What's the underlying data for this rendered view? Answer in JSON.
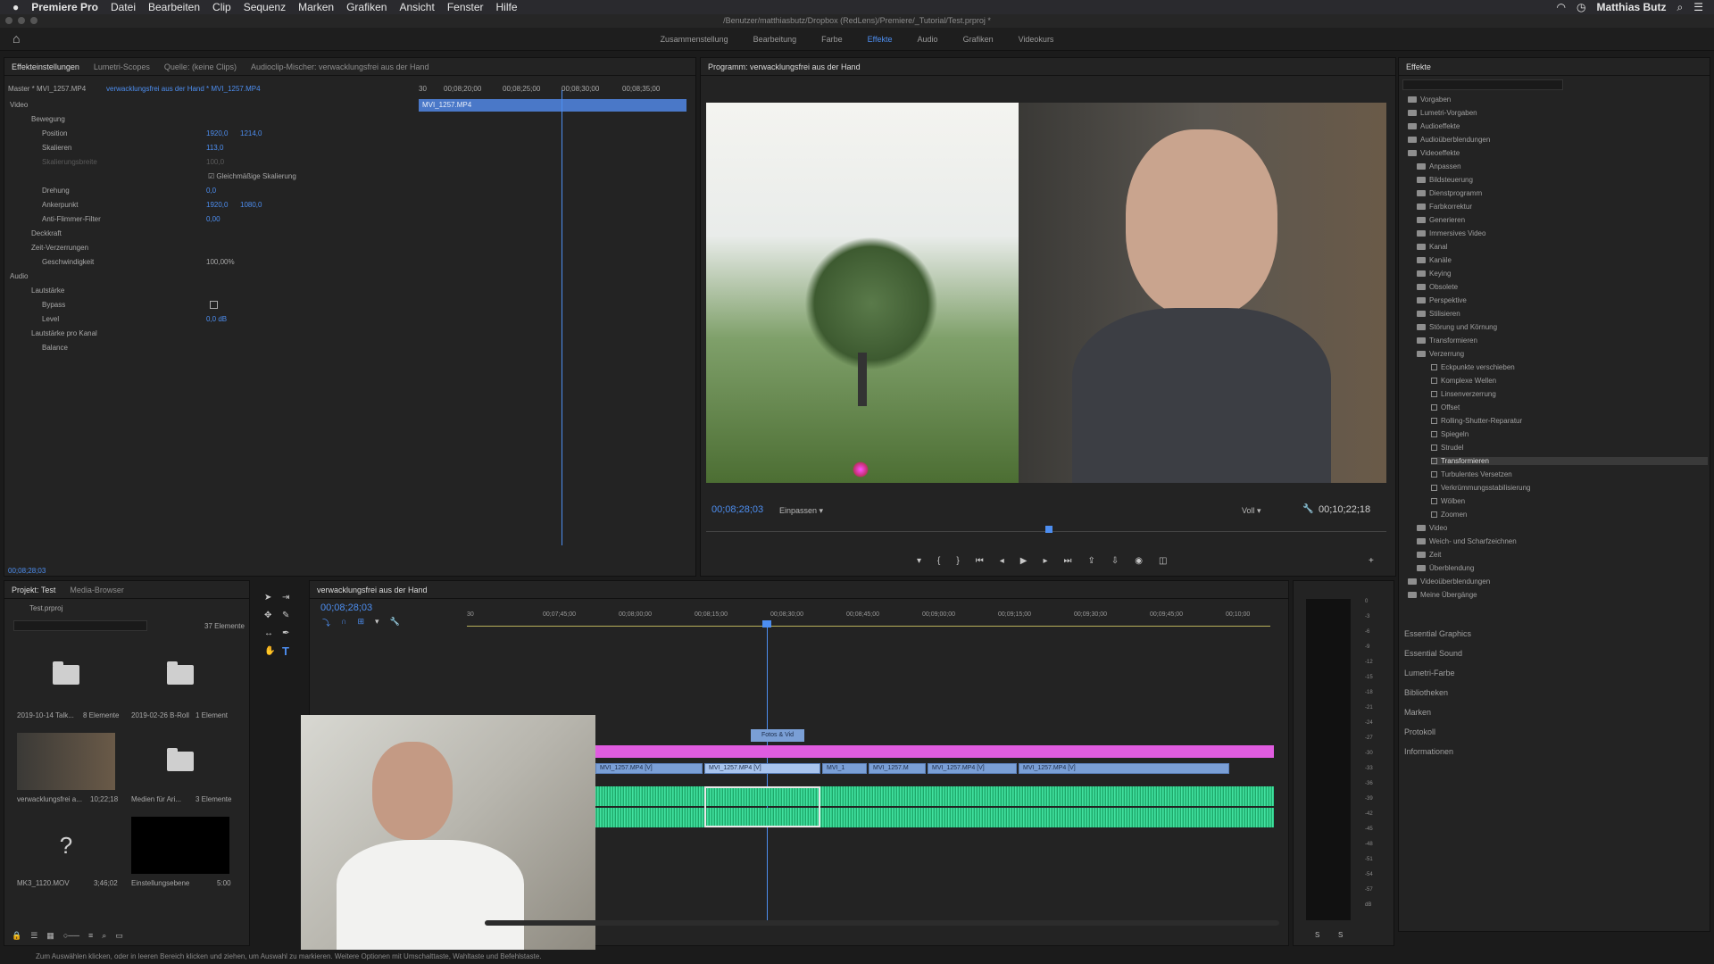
{
  "menubar": {
    "apple": "",
    "app": "Premiere Pro",
    "items": [
      "Datei",
      "Bearbeiten",
      "Clip",
      "Sequenz",
      "Marken",
      "Grafiken",
      "Ansicht",
      "Fenster",
      "Hilfe"
    ],
    "user": "Matthias Butz"
  },
  "titlebar": {
    "path": "/Benutzer/matthiasbutz/Dropbox (RedLens)/Premiere/_Tutorial/Test.prproj *"
  },
  "workspace": {
    "items": [
      "Zusammenstellung",
      "Bearbeitung",
      "Farbe",
      "Effekte",
      "Audio",
      "Grafiken",
      "Videokurs"
    ],
    "active": "Effekte"
  },
  "effect_controls": {
    "tabs": [
      "Effekteinstellungen",
      "Lumetri-Scopes",
      "Quelle: (keine Clips)",
      "Audioclip-Mischer: verwacklungsfrei aus der Hand"
    ],
    "master": "Master * MVI_1257.MP4",
    "sequence_clip": "verwacklungsfrei aus der Hand * MVI_1257.MP4",
    "ruler": [
      "30",
      "00;08;20;00",
      "00;08;25;00",
      "00;08;30;00",
      "00;08;35;00"
    ],
    "clip_bar": "MVI_1257.MP4",
    "video_label": "Video",
    "audio_label": "Audio",
    "bewegung": "Bewegung",
    "position": {
      "label": "Position",
      "x": "1920,0",
      "y": "1214,0"
    },
    "skalieren": {
      "label": "Skalieren",
      "value": "113,0"
    },
    "skalierungsbreite": {
      "label": "Skalierungsbreite",
      "value": "100,0"
    },
    "gleichmaessig": "Gleichmäßige Skalierung",
    "drehung": {
      "label": "Drehung",
      "value": "0,0"
    },
    "ankerpunkt": {
      "label": "Ankerpunkt",
      "x": "1920,0",
      "y": "1080,0"
    },
    "anti_flimmer": {
      "label": "Anti-Flimmer-Filter",
      "value": "0,00"
    },
    "deckkraft": "Deckkraft",
    "zeit_verzerrungen": "Zeit-Verzerrungen",
    "geschwindigkeit": {
      "label": "Geschwindigkeit",
      "value": "100,00%"
    },
    "lautstaerke": "Lautstärke",
    "bypass": "Bypass",
    "level": {
      "label": "Level",
      "value": "0,0 dB"
    },
    "lautstaerke_kanal": "Lautstärke pro Kanal",
    "balance": "Balance",
    "timecode": "00;08;28;03"
  },
  "program_monitor": {
    "title": "Programm: verwacklungsfrei aus der Hand",
    "timecode": "00;08;28;03",
    "fit": "Einpassen",
    "quality": "Voll",
    "duration": "00;10;22;18"
  },
  "effects_panel": {
    "title": "Effekte",
    "top_items": [
      "Vorgaben",
      "Lumetri-Vorgaben",
      "Audioeffekte",
      "Audioüberblendungen",
      "Videoeffekte"
    ],
    "video_effects": [
      "Anpassen",
      "Bildsteuerung",
      "Dienstprogramm",
      "Farbkorrektur",
      "Generieren",
      "Immersives Video",
      "Kanal",
      "Kanäle",
      "Keying",
      "Obsolete",
      "Perspektive",
      "Stilisieren",
      "Störung und Körnung",
      "Transformieren",
      "Verzerrung"
    ],
    "verzerrung_items": [
      "Eckpunkte verschieben",
      "Komplexe Wellen",
      "Linsenverzerrung",
      "Offset",
      "Rolling-Shutter-Reparatur",
      "Spiegeln",
      "Strudel",
      "Transformieren",
      "Turbulentes Versetzen",
      "Verkrümmungsstabilisierung",
      "Wölben",
      "Zoomen"
    ],
    "selected": "Transformieren",
    "after_items": [
      "Video",
      "Weich- und Scharfzeichnen",
      "Zeit",
      "Überblendung"
    ],
    "bottom_items": [
      "Videoüberblendungen",
      "Meine Übergänge"
    ],
    "sections": [
      "Essential Graphics",
      "Essential Sound",
      "Lumetri-Farbe",
      "Bibliotheken",
      "Marken",
      "Protokoll",
      "Informationen"
    ]
  },
  "project": {
    "tabs": [
      "Projekt: Test",
      "Media-Browser"
    ],
    "file": "Test.prproj",
    "count": "37 Elemente",
    "items": [
      {
        "name": "2019-10-14 Talk...",
        "meta": "8 Elemente"
      },
      {
        "name": "2019-02-26 B-Roll",
        "meta": "1 Element"
      },
      {
        "name": "verwacklungsfrei a...",
        "meta": "10;22;18"
      },
      {
        "name": "Medien für Ari...",
        "meta": "3 Elemente"
      },
      {
        "name": "MK3_1120.MOV",
        "meta": "3;46;02"
      },
      {
        "name": "Einstellungsebene",
        "meta": "5:00"
      }
    ]
  },
  "timeline": {
    "title": "verwacklungsfrei aus der Hand",
    "timecode": "00;08;28;03",
    "ruler": [
      "30",
      "00;07;45;00",
      "00;08;00;00",
      "00;08;15;00",
      "00;08;30;00",
      "00;08;45;00",
      "00;09;00;00",
      "00;09;15;00",
      "00;09;30;00",
      "00;09;45;00",
      "00;10;00"
    ],
    "graphic_clip": "Fotos & Vid",
    "clips": [
      "MVI_1257.MP4 [V]",
      "MVI_1257.MP4 [V]",
      "MVI_1",
      "MVI_1257.M",
      "MVI_1257.MP4 [V]",
      "MVI_1257.MP4 [V]"
    ]
  },
  "meter": {
    "labels": [
      "0",
      "-3",
      "-6",
      "-9",
      "-12",
      "-15",
      "-18",
      "-21",
      "-24",
      "-27",
      "-30",
      "-33",
      "-36",
      "-39",
      "-42",
      "-45",
      "-48",
      "-51",
      "-54",
      "-57",
      "dB"
    ],
    "ch": [
      "S",
      "S"
    ]
  },
  "status": "Zum Auswählen klicken, oder in leeren Bereich klicken und ziehen, um Auswahl zu markieren. Weitere Optionen mit Umschalttaste, Wahltaste und Befehlstaste.",
  "colors": {
    "accent": "#4d8ef0",
    "graphic_track": "#e05ce0",
    "audio": "#2ecc8a",
    "video_clip": "#7a9fd6"
  }
}
